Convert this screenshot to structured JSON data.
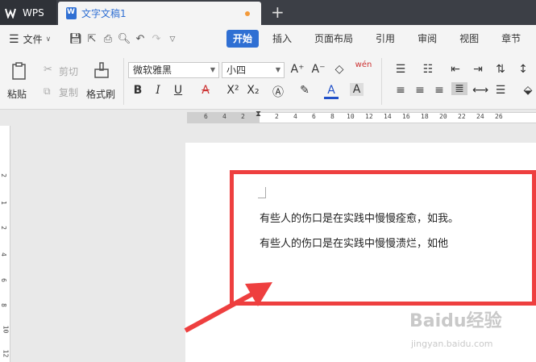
{
  "titlebar": {
    "app_tab": "WPS",
    "doc_tab": "文字文稿1",
    "new_tab": "+"
  },
  "menubar": {
    "file": "文件",
    "tabs": [
      "开始",
      "插入",
      "页面布局",
      "引用",
      "审阅",
      "视图",
      "章节"
    ]
  },
  "ribbon": {
    "paste": "粘贴",
    "cut": "剪切",
    "copy": "复制",
    "format_painter": "格式刷",
    "font_name": "微软雅黑",
    "font_size": "小四",
    "phonetic": "wén"
  },
  "ruler": {
    "top_numbers": [
      "6",
      "4",
      "2",
      "2",
      "2",
      "4",
      "6",
      "8",
      "10",
      "12",
      "14",
      "16",
      "18",
      "20",
      "22",
      "24",
      "26"
    ],
    "left_numbers": [
      "2",
      "1",
      "2",
      "4",
      "6",
      "8",
      "10",
      "12"
    ]
  },
  "document": {
    "lines": [
      "有些人的伤口是在实践中慢慢痊愈，如我。",
      "有些人的伤口是在实践中慢慢溃烂，如他"
    ]
  },
  "watermark": {
    "logo": "Baidu经验",
    "url": "jingyan.baidu.com"
  },
  "colors": {
    "accent": "#2f6fd3",
    "annotation": "#ee3f3f"
  }
}
